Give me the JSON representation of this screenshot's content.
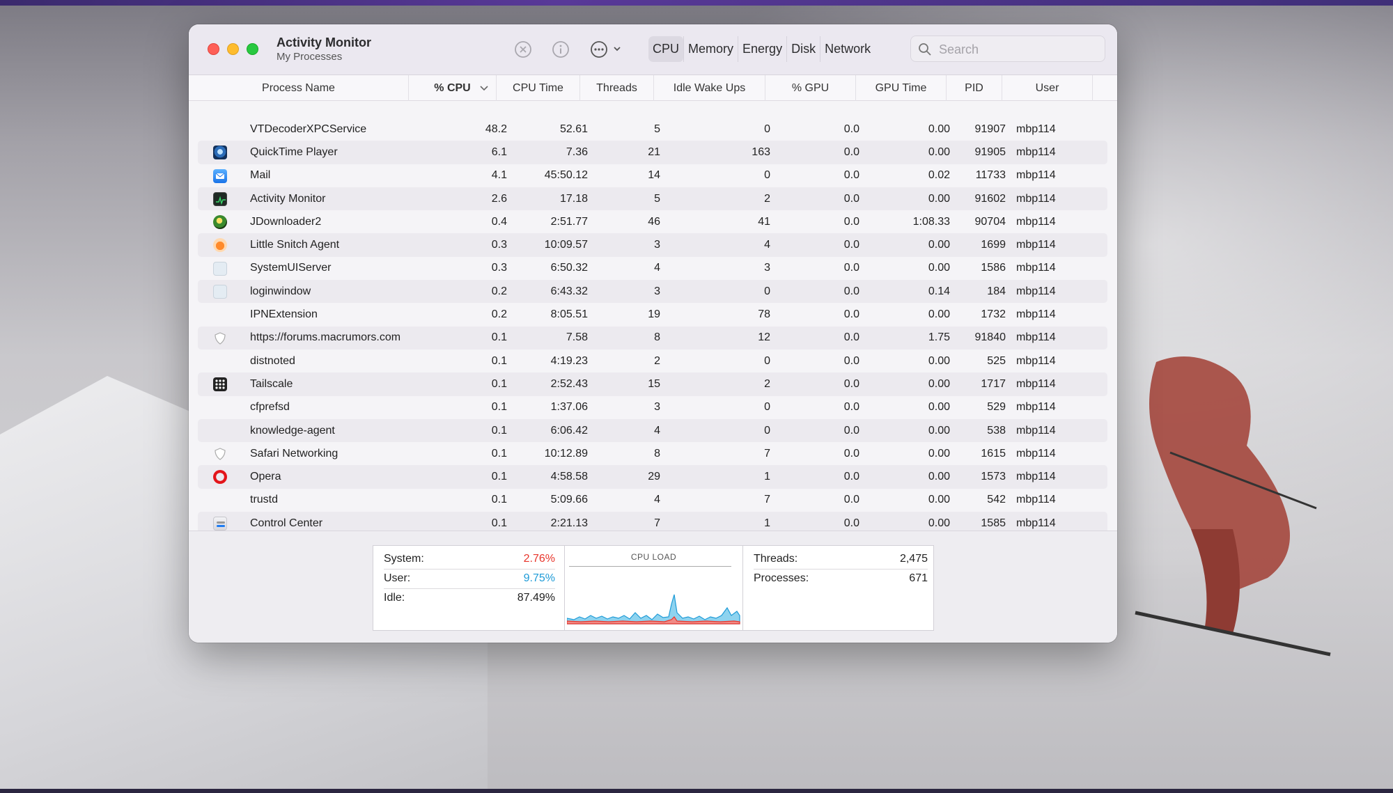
{
  "window": {
    "title": "Activity Monitor",
    "subtitle": "My Processes"
  },
  "toolbar": {
    "tabs": [
      "CPU",
      "Memory",
      "Energy",
      "Disk",
      "Network"
    ],
    "active_tab": "CPU",
    "search_placeholder": "Search"
  },
  "table": {
    "columns": [
      "Process Name",
      "% CPU",
      "CPU Time",
      "Threads",
      "Idle Wake Ups",
      "% GPU",
      "GPU Time",
      "PID",
      "User"
    ],
    "sorted_column": "% CPU",
    "rows": [
      {
        "icon": "none",
        "name": "VTDecoderXPCService",
        "cpu": "48.2",
        "cpu_time": "52.61",
        "threads": "5",
        "idle": "0",
        "gpu": "0.0",
        "gpu_time": "0.00",
        "pid": "91907",
        "user": "mbp114"
      },
      {
        "icon": "quicktime-icon",
        "name": "QuickTime Player",
        "cpu": "6.1",
        "cpu_time": "7.36",
        "threads": "21",
        "idle": "163",
        "gpu": "0.0",
        "gpu_time": "0.00",
        "pid": "91905",
        "user": "mbp114"
      },
      {
        "icon": "mail-icon",
        "name": "Mail",
        "cpu": "4.1",
        "cpu_time": "45:50.12",
        "threads": "14",
        "idle": "0",
        "gpu": "0.0",
        "gpu_time": "0.02",
        "pid": "11733",
        "user": "mbp114"
      },
      {
        "icon": "activity-monitor-icon",
        "name": "Activity Monitor",
        "cpu": "2.6",
        "cpu_time": "17.18",
        "threads": "5",
        "idle": "2",
        "gpu": "0.0",
        "gpu_time": "0.00",
        "pid": "91602",
        "user": "mbp114"
      },
      {
        "icon": "jdownloader-icon",
        "name": "JDownloader2",
        "cpu": "0.4",
        "cpu_time": "2:51.77",
        "threads": "46",
        "idle": "41",
        "gpu": "0.0",
        "gpu_time": "1:08.33",
        "pid": "90704",
        "user": "mbp114"
      },
      {
        "icon": "little-snitch-icon",
        "name": "Little Snitch Agent",
        "cpu": "0.3",
        "cpu_time": "10:09.57",
        "threads": "3",
        "idle": "4",
        "gpu": "0.0",
        "gpu_time": "0.00",
        "pid": "1699",
        "user": "mbp114"
      },
      {
        "icon": "generic-app-icon",
        "name": "SystemUIServer",
        "cpu": "0.3",
        "cpu_time": "6:50.32",
        "threads": "4",
        "idle": "3",
        "gpu": "0.0",
        "gpu_time": "0.00",
        "pid": "1586",
        "user": "mbp114"
      },
      {
        "icon": "generic-app-icon",
        "name": "loginwindow",
        "cpu": "0.2",
        "cpu_time": "6:43.32",
        "threads": "3",
        "idle": "0",
        "gpu": "0.0",
        "gpu_time": "0.14",
        "pid": "184",
        "user": "mbp114"
      },
      {
        "icon": "none",
        "name": "IPNExtension",
        "cpu": "0.2",
        "cpu_time": "8:05.51",
        "threads": "19",
        "idle": "78",
        "gpu": "0.0",
        "gpu_time": "0.00",
        "pid": "1732",
        "user": "mbp114"
      },
      {
        "icon": "shield-icon",
        "name": "https://forums.macrumors.com",
        "cpu": "0.1",
        "cpu_time": "7.58",
        "threads": "8",
        "idle": "12",
        "gpu": "0.0",
        "gpu_time": "1.75",
        "pid": "91840",
        "user": "mbp114"
      },
      {
        "icon": "none",
        "name": "distnoted",
        "cpu": "0.1",
        "cpu_time": "4:19.23",
        "threads": "2",
        "idle": "0",
        "gpu": "0.0",
        "gpu_time": "0.00",
        "pid": "525",
        "user": "mbp114"
      },
      {
        "icon": "tailscale-icon",
        "name": "Tailscale",
        "cpu": "0.1",
        "cpu_time": "2:52.43",
        "threads": "15",
        "idle": "2",
        "gpu": "0.0",
        "gpu_time": "0.00",
        "pid": "1717",
        "user": "mbp114"
      },
      {
        "icon": "none",
        "name": "cfprefsd",
        "cpu": "0.1",
        "cpu_time": "1:37.06",
        "threads": "3",
        "idle": "0",
        "gpu": "0.0",
        "gpu_time": "0.00",
        "pid": "529",
        "user": "mbp114"
      },
      {
        "icon": "none",
        "name": "knowledge-agent",
        "cpu": "0.1",
        "cpu_time": "6:06.42",
        "threads": "4",
        "idle": "0",
        "gpu": "0.0",
        "gpu_time": "0.00",
        "pid": "538",
        "user": "mbp114"
      },
      {
        "icon": "shield-icon",
        "name": "Safari Networking",
        "cpu": "0.1",
        "cpu_time": "10:12.89",
        "threads": "8",
        "idle": "7",
        "gpu": "0.0",
        "gpu_time": "0.00",
        "pid": "1615",
        "user": "mbp114"
      },
      {
        "icon": "opera-icon",
        "name": "Opera",
        "cpu": "0.1",
        "cpu_time": "4:58.58",
        "threads": "29",
        "idle": "1",
        "gpu": "0.0",
        "gpu_time": "0.00",
        "pid": "1573",
        "user": "mbp114"
      },
      {
        "icon": "none",
        "name": "trustd",
        "cpu": "0.1",
        "cpu_time": "5:09.66",
        "threads": "4",
        "idle": "7",
        "gpu": "0.0",
        "gpu_time": "0.00",
        "pid": "542",
        "user": "mbp114"
      },
      {
        "icon": "control-center-icon",
        "name": "Control Center",
        "cpu": "0.1",
        "cpu_time": "2:21.13",
        "threads": "7",
        "idle": "1",
        "gpu": "0.0",
        "gpu_time": "0.00",
        "pid": "1585",
        "user": "mbp114"
      }
    ]
  },
  "footer": {
    "stats_left": [
      {
        "label": "System:",
        "value": "2.76%",
        "color": "#e8352b"
      },
      {
        "label": "User:",
        "value": "9.75%",
        "color": "#1e9bd7"
      },
      {
        "label": "Idle:",
        "value": "87.49%",
        "color": "#222222"
      }
    ],
    "cpu_load_title": "CPU LOAD",
    "stats_right": [
      {
        "label": "Threads:",
        "value": "2,475"
      },
      {
        "label": "Processes:",
        "value": "671"
      }
    ]
  },
  "colors": {
    "system_red": "#e8352b",
    "user_blue": "#1e9bd7"
  }
}
